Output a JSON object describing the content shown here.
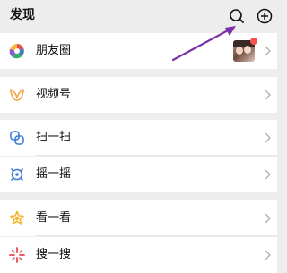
{
  "header": {
    "title": "发现",
    "search_icon": "search-icon",
    "add_icon": "plus-circle-icon"
  },
  "items": [
    {
      "label": "朋友圈",
      "icon": "moments-aperture-icon",
      "has_avatar": true,
      "has_badge_dot": true
    },
    {
      "label": "视频号",
      "icon": "channels-butterfly-icon"
    },
    {
      "label": "扫一扫",
      "icon": "scan-icon"
    },
    {
      "label": "摇一摇",
      "icon": "shake-icon"
    },
    {
      "label": "看一看",
      "icon": "top-stories-icon"
    },
    {
      "label": "搜一搜",
      "icon": "search-star-icon"
    }
  ],
  "annotation": {
    "type": "arrow",
    "color": "#7b2fa8",
    "points_to": "search-icon"
  },
  "colors": {
    "background": "#ededed",
    "row_background": "#ffffff",
    "badge_red": "#fa5151",
    "moments": "#f6b73c",
    "channels": "#f0a64a",
    "scan": "#3d7dd8",
    "shake": "#3d7dd8",
    "top_stories": "#f5b52a",
    "search": "#e8484d",
    "arrow": "#7b2fa8"
  }
}
